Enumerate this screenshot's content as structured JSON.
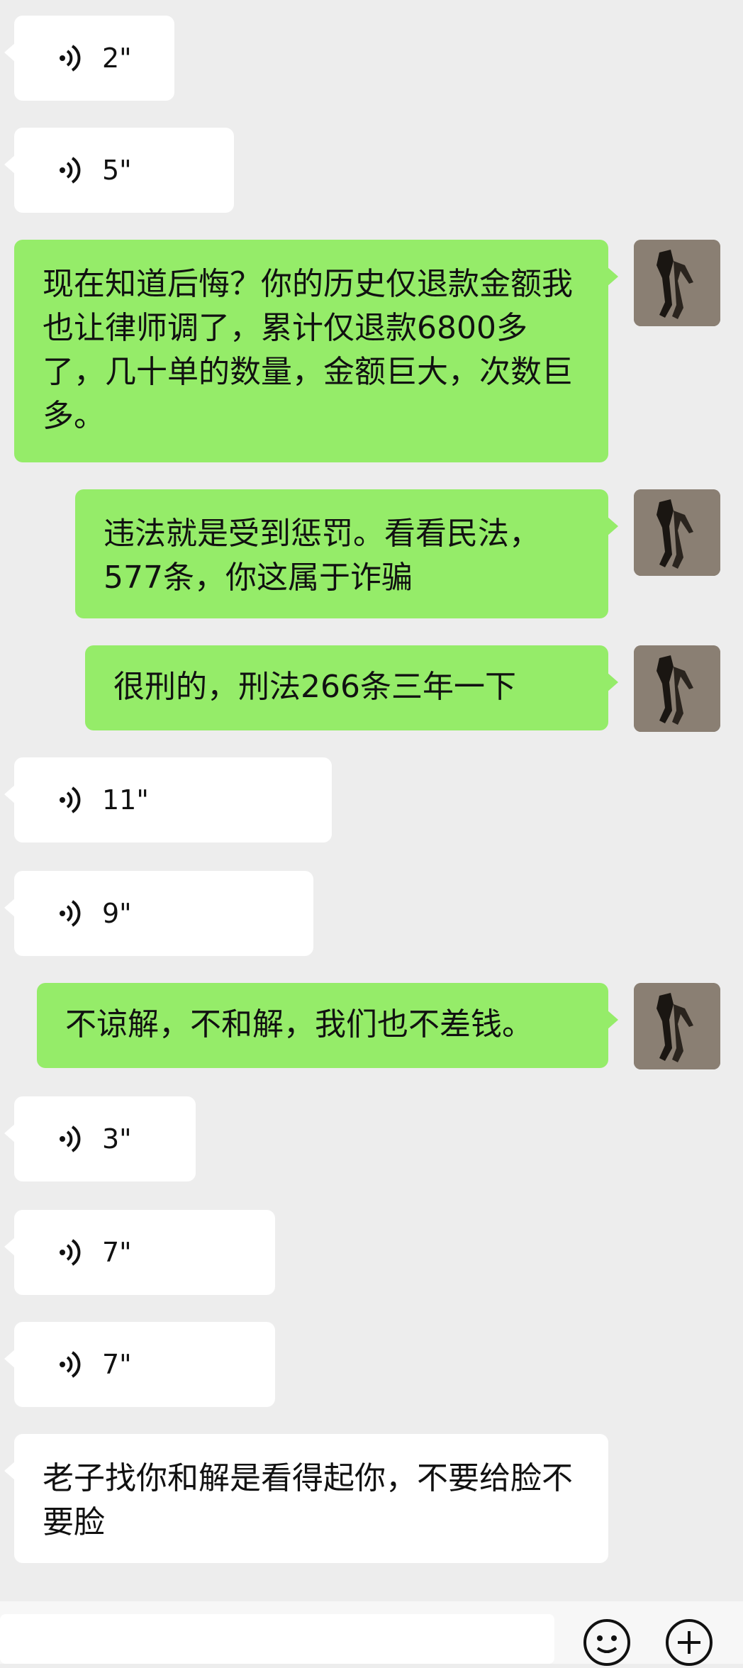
{
  "messages": [
    {
      "side": "left",
      "type": "voice",
      "duration": "2\""
    },
    {
      "side": "left",
      "type": "voice",
      "duration": "5\""
    },
    {
      "side": "right",
      "type": "text",
      "text": "现在知道后悔？你的历史仅退款金额我也让律师调了，累计仅退款6800多了，几十单的数量，金额巨大，次数巨多。"
    },
    {
      "side": "right",
      "type": "text",
      "text": "违法就是受到惩罚。看看民法，577条，你这属于诈骗"
    },
    {
      "side": "right",
      "type": "text",
      "text": "很刑的，刑法266条三年一下"
    },
    {
      "side": "left",
      "type": "voice",
      "duration": "11\""
    },
    {
      "side": "left",
      "type": "voice",
      "duration": "9\""
    },
    {
      "side": "right",
      "type": "text",
      "text": "不谅解，不和解，我们也不差钱。"
    },
    {
      "side": "left",
      "type": "voice",
      "duration": "3\""
    },
    {
      "side": "left",
      "type": "voice",
      "duration": "7\""
    },
    {
      "side": "left",
      "type": "voice",
      "duration": "7\""
    },
    {
      "side": "left",
      "type": "text",
      "text": "老子找你和解是看得起你，不要给脸不要脸"
    }
  ],
  "colors": {
    "background": "#ededed",
    "incoming": "#ffffff",
    "outgoing": "#95ec69"
  },
  "icons": {
    "emoji": "smiley-icon",
    "more": "plus-icon",
    "voice": "voice-wave-icon"
  }
}
